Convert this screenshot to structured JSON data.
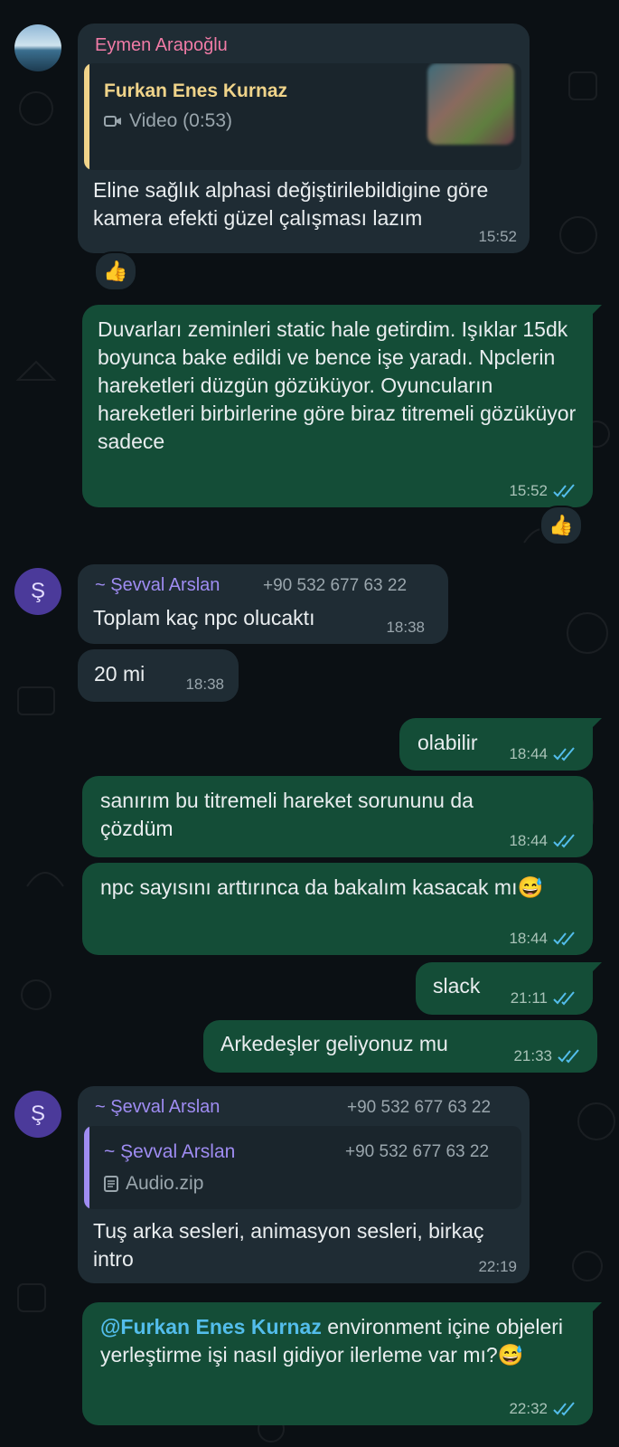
{
  "colors": {
    "background": "#0b1014",
    "incoming_bubble": "#1f2c34",
    "outgoing_bubble": "#144d37",
    "eymen_name": "#f07ba6",
    "quote_furkan": "#f0d48a",
    "sevval_name": "#9f8cf2",
    "mention": "#53bdeb",
    "read_ticks": "#53bdeb"
  },
  "messages": {
    "m1": {
      "sender": "Eymen Arapoğlu",
      "quote_author": "Furkan Enes Kurnaz",
      "quote_media": "Video (0:53)",
      "text": "Eline sağlık alphasi değiştirilebildigine göre kamera efekti güzel çalışması lazım",
      "time": "15:52",
      "reaction": "👍"
    },
    "m2": {
      "text": "Duvarları zeminleri static hale getirdim. Işıklar 15dk boyunca bake edildi ve bence işe yaradı. Npclerin hareketleri düzgün gözüküyor. Oyuncuların hareketleri birbirlerine göre biraz titremeli gözüküyor sadece",
      "time": "15:52",
      "reaction": "👍"
    },
    "m3": {
      "avatar_letter": "Ş",
      "sender": "~ Şevval Arslan",
      "phone": "+90 532 677 63 22",
      "text": "Toplam kaç npc olucaktı",
      "time": "18:38"
    },
    "m4": {
      "text": "20 mi",
      "time": "18:38"
    },
    "m5": {
      "text": "olabilir",
      "time": "18:44"
    },
    "m6": {
      "text": "sanırım bu titremeli hareket sorununu da çözdüm",
      "time": "18:44"
    },
    "m7": {
      "text": "npc sayısını arttırınca da bakalım kasacak mı😅",
      "time": "18:44"
    },
    "m8": {
      "text": "slack",
      "time": "21:11"
    },
    "m9": {
      "text": "Arkedeşler geliyonuz mu",
      "time": "21:33"
    },
    "m10": {
      "avatar_letter": "Ş",
      "sender": "~ Şevval Arslan",
      "phone": "+90 532 677 63 22",
      "quote_author": "~ Şevval Arslan",
      "quote_phone": "+90 532 677 63 22",
      "quote_file": "Audio.zip",
      "text": "Tuş arka sesleri, animasyon sesleri, birkaç intro",
      "time": "22:19"
    },
    "m11": {
      "mention": "@Furkan Enes Kurnaz",
      "text": " environment içine objeleri yerleştirme işi nasıl gidiyor ilerleme var mı?😅",
      "time": "22:32"
    }
  },
  "icons": [
    "video-icon",
    "document-icon",
    "double-check-icon",
    "thumbs-up-icon"
  ]
}
